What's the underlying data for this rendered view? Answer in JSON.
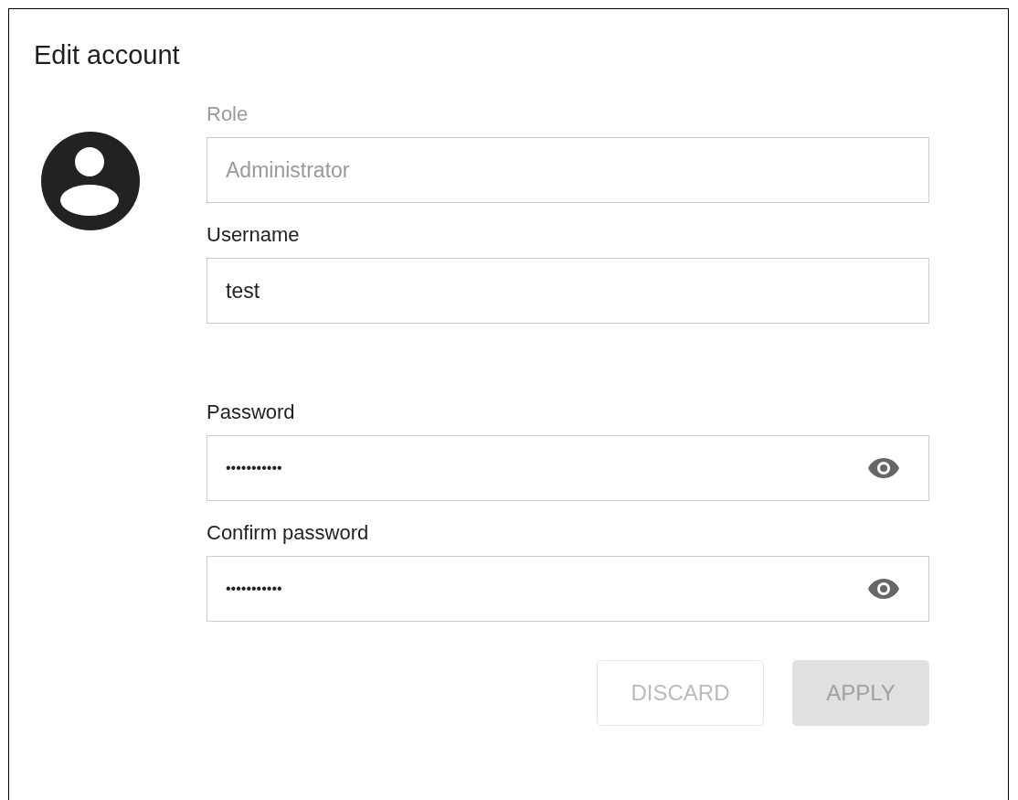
{
  "title": "Edit account",
  "fields": [
    {
      "label": "Role",
      "value": "Administrator",
      "kind": "text",
      "disabled": true
    },
    {
      "label": "Username",
      "value": "test",
      "kind": "text",
      "disabled": false
    },
    {
      "label": "Password",
      "value": "•••••••••••",
      "kind": "password",
      "disabled": false
    },
    {
      "label": "Confirm password",
      "value": "•••••••••••",
      "kind": "password",
      "disabled": false
    }
  ],
  "buttons": [
    {
      "label": "DISCARD",
      "kind": "outlined",
      "disabled": true
    },
    {
      "label": "APPLY",
      "kind": "filled",
      "disabled": true
    }
  ]
}
